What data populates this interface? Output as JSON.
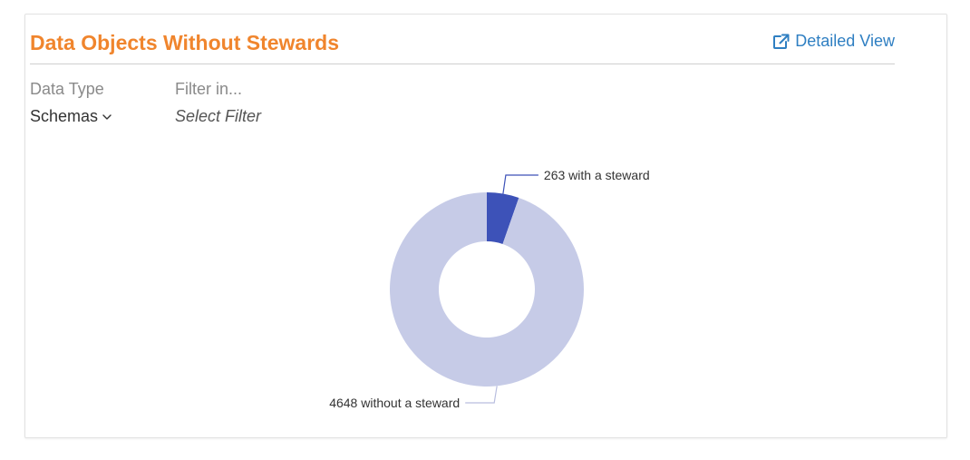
{
  "widget": {
    "title": "Data Objects Without Stewards",
    "detailed_view_label": "Detailed View",
    "link_color": "#2f7fc2",
    "title_color": "#f0852d"
  },
  "filters": {
    "data_type": {
      "label": "Data Type",
      "selected": "Schemas"
    },
    "filter_in": {
      "label": "Filter in...",
      "placeholder": "Select Filter"
    }
  },
  "chart_data": {
    "type": "pie",
    "donut": true,
    "slices": [
      {
        "label": "263 with a steward",
        "value": 263,
        "color": "#3d52b8"
      },
      {
        "label": "4648 without a steward",
        "value": 4648,
        "color": "#c6cbe7"
      }
    ]
  }
}
